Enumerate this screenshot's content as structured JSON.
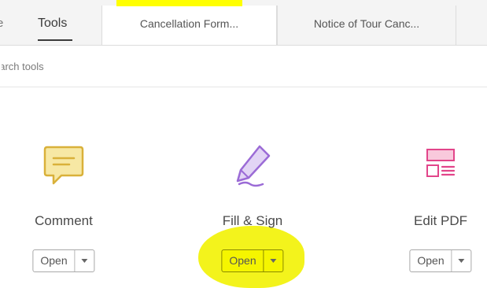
{
  "tabs": {
    "home_partial": "e",
    "tools": "Tools",
    "documents": [
      {
        "title": "Cancellation Form..."
      },
      {
        "title": "Notice of Tour Canc..."
      }
    ]
  },
  "search": {
    "placeholder": "earch tools"
  },
  "tools": [
    {
      "name": "Comment",
      "icon": "comment-icon",
      "color": "#e8c54a",
      "open_label": "Open"
    },
    {
      "name": "Fill & Sign",
      "icon": "pen-sign-icon",
      "color": "#9b6bd6",
      "open_label": "Open"
    },
    {
      "name": "Edit PDF",
      "icon": "edit-pdf-icon",
      "color": "#e2458a",
      "open_label": "Open"
    }
  ],
  "colors": {
    "highlight": "#ffff00",
    "tabbar_bg": "#f4f4f4"
  }
}
